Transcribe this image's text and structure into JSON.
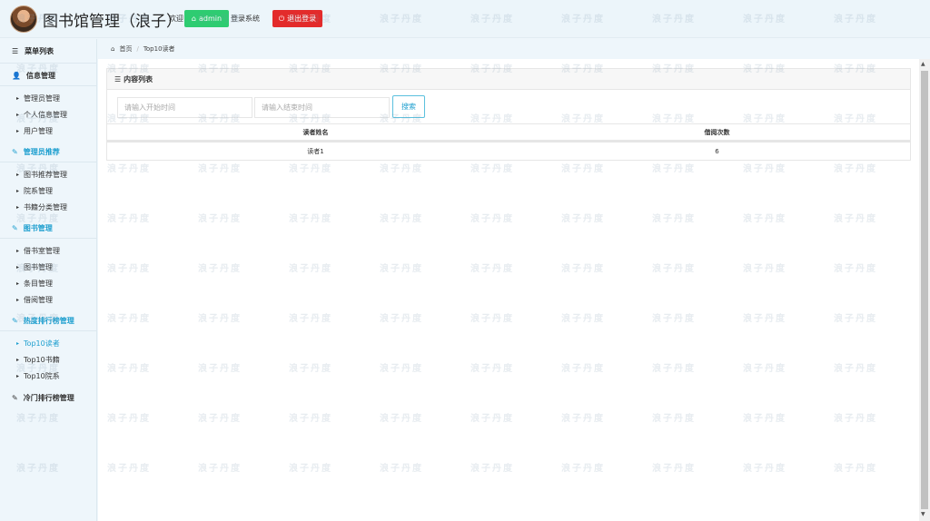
{
  "header": {
    "title": "图书馆管理（浪子）",
    "welcome": "欢迎",
    "user_button": "admin",
    "login_text": "登录系统",
    "logout_button": "退出登录",
    "colors": {
      "user_button": "#2ecc71",
      "logout_button": "#e32b2b"
    }
  },
  "sidebar": {
    "menu_title": "菜单列表",
    "groups": [
      {
        "label": "信息管理",
        "icon": "user-icon",
        "items": [
          "管理员管理",
          "个人信息管理",
          "用户管理"
        ]
      },
      {
        "label": "管理员推荐",
        "icon": "edit-icon",
        "items": [
          "图书推荐管理",
          "院系管理",
          "书籍分类管理"
        ]
      },
      {
        "label": "图书管理",
        "icon": "edit-icon",
        "items": [
          "借书室管理",
          "图书管理",
          "条目管理",
          "借阅管理"
        ]
      },
      {
        "label": "热度排行榜管理",
        "icon": "edit-icon",
        "items": [
          "Top10读者",
          "Top10书籍",
          "Top10院系"
        ]
      },
      {
        "label": "冷门排行榜管理",
        "icon": "edit-icon",
        "items": []
      }
    ],
    "active_item": "Top10读者",
    "accent_color": "#1e9fcf"
  },
  "breadcrumb": {
    "home": "首页",
    "current": "Top10读者"
  },
  "panel": {
    "title": "内容列表",
    "start_placeholder": "请输入开始时间",
    "end_placeholder": "请输入结束时间",
    "search_button": "搜索"
  },
  "table": {
    "columns": [
      "读者姓名",
      "借阅次数"
    ],
    "rows": [
      [
        "读者1",
        "6"
      ]
    ]
  },
  "watermark": {
    "text": "浪子丹度"
  }
}
